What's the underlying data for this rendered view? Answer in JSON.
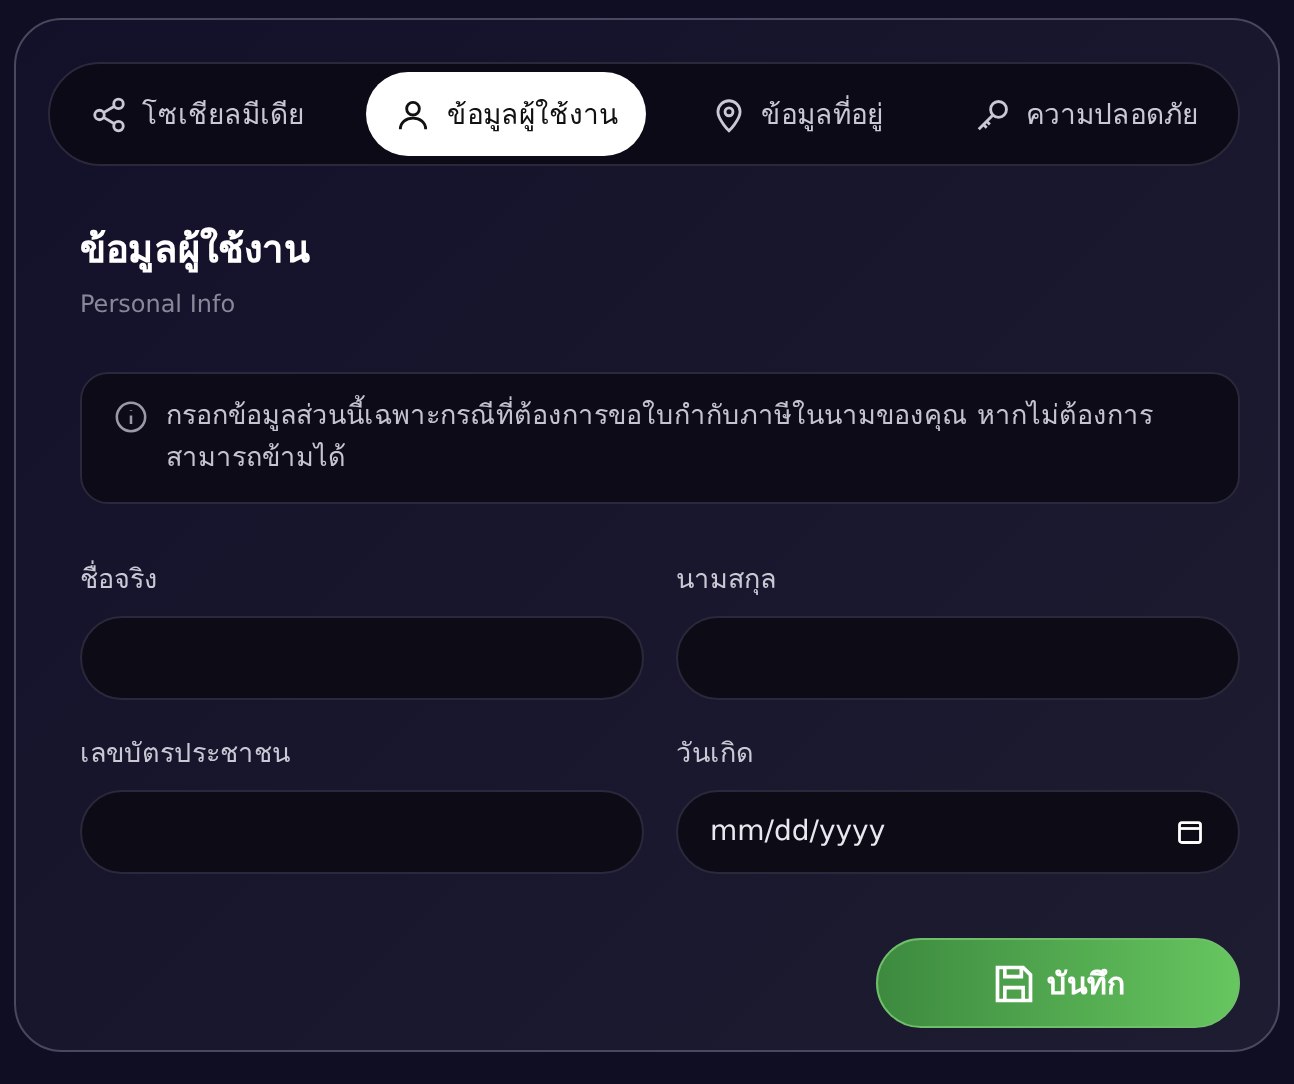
{
  "tabs": [
    {
      "label": "โซเชียลมีเดีย",
      "selected": false
    },
    {
      "label": "ข้อมูลผู้ใช้งาน",
      "selected": true
    },
    {
      "label": "ข้อมูลที่อยู่",
      "selected": false
    },
    {
      "label": "ความปลอดภัย",
      "selected": false
    }
  ],
  "section": {
    "title": "ข้อมูลผู้ใช้งาน",
    "subtitle": "Personal Info"
  },
  "notice": "กรอกข้อมูลส่วนนี้เฉพาะกรณีที่ต้องการขอใบกำกับภาษีในนามของคุณ หากไม่ต้องการสามารถข้ามได้",
  "fields": [
    {
      "label": "ชื่อจริง",
      "kind": "text"
    },
    {
      "label": "นามสกุล",
      "kind": "text"
    },
    {
      "label": "เลขบัตรประชาชน",
      "kind": "text"
    },
    {
      "label": "วันเกิด",
      "kind": "date",
      "placeholder": "mm/dd/yyyy"
    }
  ],
  "save_button": "บันทึก"
}
